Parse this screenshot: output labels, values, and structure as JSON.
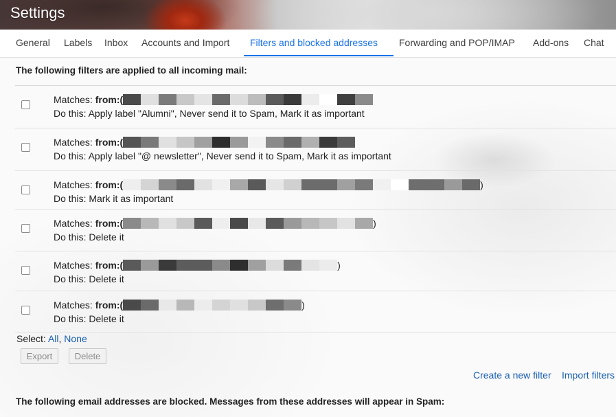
{
  "header": {
    "title": "Settings"
  },
  "tabs": [
    {
      "label": "General",
      "active": false
    },
    {
      "label": "Labels",
      "active": false
    },
    {
      "label": "Inbox",
      "active": false
    },
    {
      "label": "Accounts and Import",
      "active": false
    },
    {
      "label": "Filters and blocked addresses",
      "active": true
    },
    {
      "label": "Forwarding and POP/IMAP",
      "active": false
    },
    {
      "label": "Add-ons",
      "active": false
    },
    {
      "label": "Chat",
      "active": false
    }
  ],
  "filters_heading": "The following filters are applied to all incoming mail:",
  "filters": [
    {
      "matches_label": "Matches:",
      "from_label": "from:(",
      "close_paren": "",
      "action": "Do this: Apply label \"Alumni\", Never send it to Spam, Mark it as important",
      "redacted": [
        "#4a4a4a",
        "#e0e0e0",
        "#7a7a7a",
        "#c8c8c8",
        "#e4e4e4",
        "#6a6a6a",
        "#dcdcdc",
        "#bcbcbc",
        "#5a5a5a",
        "#3a3a3a",
        "#ececec",
        "#ffffff",
        "#3f3f3f",
        "#8a8a8a"
      ]
    },
    {
      "matches_label": "Matches:",
      "from_label": "from:(",
      "close_paren": "",
      "action": "Do this: Apply label \"@ newsletter\", Never send it to Spam, Mark it as important",
      "redacted": [
        "#555555",
        "#7a7a7a",
        "#e0e0e0",
        "#c6c6c6",
        "#a0a0a0",
        "#2e2e2e",
        "#9a9a9a",
        "#f2f2f2",
        "#8a8a8a",
        "#6a6a6a",
        "#b0b0b0",
        "#3a3a3a",
        "#5c5c5c"
      ]
    },
    {
      "matches_label": "Matches:",
      "from_label": "from:(",
      "close_paren": ")",
      "action": "Do this: Mark it as important",
      "redacted": [
        "#eeeeee",
        "#d4d4d4",
        "#8a8a8a",
        "#6a6a6a",
        "#e2e2e2",
        "#f0f0f0",
        "#a8a8a8",
        "#5a5a5a",
        "#e6e6e6",
        "#d0d0d0",
        "#6c6c6c",
        "#6c6c6c",
        "#a0a0a0",
        "#7a7a7a",
        "#f0f0f0",
        "#ffffff",
        "#6e6e6e",
        "#6e6e6e",
        "#9a9a9a",
        "#6a6a6a"
      ]
    },
    {
      "matches_label": "Matches:",
      "from_label": "from:(",
      "close_paren": ")",
      "action": "Do this: Delete it",
      "redacted": [
        "#8a8a8a",
        "#b8b8b8",
        "#e0e0e0",
        "#c8c8c8",
        "#5a5a5a",
        "#eeeeee",
        "#4a4a4a",
        "#e8e8e8",
        "#5a5a5a",
        "#9a9a9a",
        "#b8b8b8",
        "#c6c6c6",
        "#e2e2e2",
        "#a8a8a8"
      ]
    },
    {
      "matches_label": "Matches:",
      "from_label": "from:(",
      "close_paren": ")",
      "action": "Do this: Delete it",
      "redacted": [
        "#5a5a5a",
        "#9a9a9a",
        "#3a3a3a",
        "#5c5c5c",
        "#5c5c5c",
        "#8a8a8a",
        "#2e2e2e",
        "#a0a0a0",
        "#dcdcdc",
        "#7a7a7a",
        "#e4e4e4",
        "#ececec"
      ]
    },
    {
      "matches_label": "Matches:",
      "from_label": "from:(",
      "close_paren": ")",
      "action": "Do this: Delete it",
      "redacted": [
        "#4a4a4a",
        "#6a6a6a",
        "#e8e8e8",
        "#b8b8b8",
        "#ececec",
        "#d4d4d4",
        "#e0e0e0",
        "#c8c8c8",
        "#6e6e6e",
        "#8a8a8a"
      ]
    }
  ],
  "select": {
    "label": "Select:",
    "all": "All",
    "separator": ",",
    "none": "None"
  },
  "buttons": {
    "export": "Export",
    "delete": "Delete"
  },
  "links": {
    "create_filter": "Create a new filter",
    "import_filters": "Import filters"
  },
  "blocked_heading": "The following email addresses are blocked. Messages from these addresses will appear in Spam:",
  "colors": {
    "accent": "#1a73e8",
    "link": "#1a5fb4"
  }
}
